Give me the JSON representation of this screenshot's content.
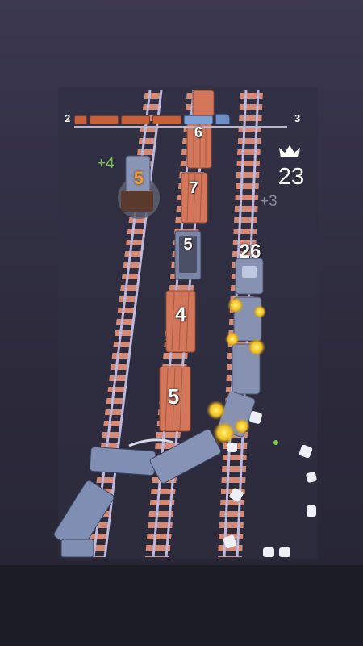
{
  "progress": {
    "current_level": "2",
    "next_level": "3",
    "train_cars": [
      "car",
      "car",
      "car",
      "car",
      "blue",
      "loco"
    ]
  },
  "hud": {
    "crown_icon": "crown-icon",
    "score": "23"
  },
  "floating_texts": {
    "bonus_left": "+4",
    "bonus_right": "+3"
  },
  "wagons": {
    "n6": "6",
    "n7": "7",
    "n5_coal": "5",
    "n4": "4",
    "n5_bottom": "5",
    "n5_falling": "5"
  },
  "player": {
    "count": "26"
  },
  "colors": {
    "rail": "#b9b3d6",
    "tie": "#e0907a",
    "log": "#d4765a",
    "wagon_gray": "#7f8fb3",
    "fire": "#f0c020"
  }
}
